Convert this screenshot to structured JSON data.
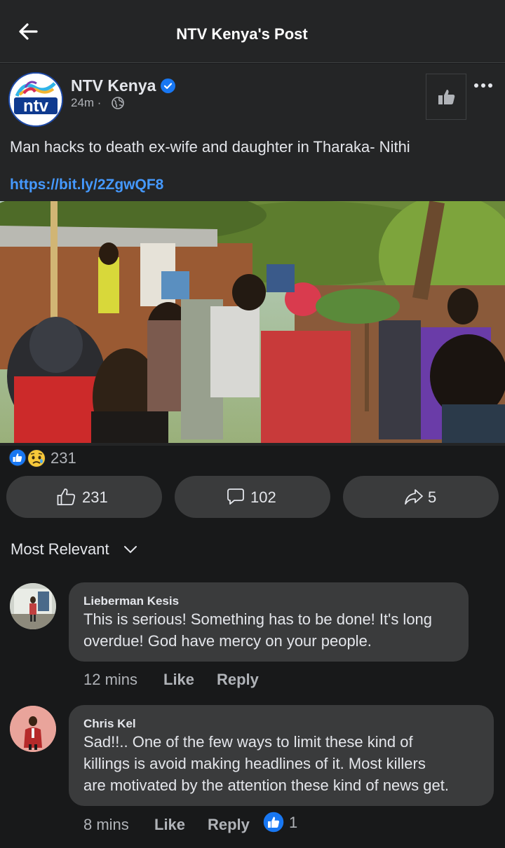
{
  "header": {
    "title": "NTV Kenya's Post"
  },
  "post": {
    "page_name": "NTV Kenya",
    "time": "24m",
    "logo_text": "ntv",
    "text": "Man hacks to death ex-wife and daughter in Tharaka- Nithi",
    "link": "https://bit.ly/2ZgwQF8"
  },
  "reactions": {
    "count": "231"
  },
  "actions": {
    "like_count": "231",
    "comment_count": "102",
    "share_count": "5"
  },
  "sort": {
    "label": "Most Relevant"
  },
  "comments": [
    {
      "author": "Lieberman Kesis",
      "lines": [
        "This is serious! Something has to be done! It's long",
        "overdue! God have mercy on your people."
      ],
      "time": "12 mins",
      "like_label": "Like",
      "reply_label": "Reply",
      "avatar_color": "#7a8a6e"
    },
    {
      "author": "Chris Kel",
      "lines": [
        "Sad!!.. One of the few ways to limit these kind of",
        "killings is  avoid making headlines of it. Most killers",
        "are motivated by the attention these kind of news get."
      ],
      "time": "8 mins",
      "like_label": "Like",
      "reply_label": "Reply",
      "reaction_count": "1",
      "avatar_color": "#e8a39b"
    }
  ],
  "colors": {
    "background": "#18191a",
    "card": "#242526",
    "bubble": "#3a3b3c",
    "link": "#4599ff",
    "like_blue": "#1877f2"
  }
}
